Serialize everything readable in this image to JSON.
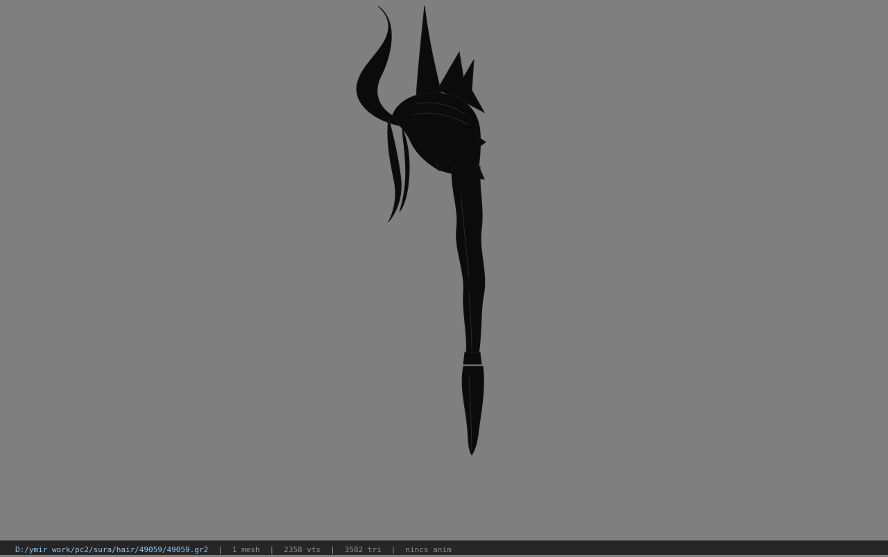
{
  "viewer": {
    "background_color": "#7f7f7f",
    "model_color": "#0b0b0b"
  },
  "status": {
    "file_path": "D:/ymir work/pc2/sura/hair/49059/49059.gr2",
    "mesh": "1 mesh",
    "vertices": "2358 vtx",
    "triangles": "3582 tri",
    "animation": "nincs anim",
    "separator": "|",
    "path_color": "#8fc1e8",
    "text_color": "#8e8e8e"
  }
}
